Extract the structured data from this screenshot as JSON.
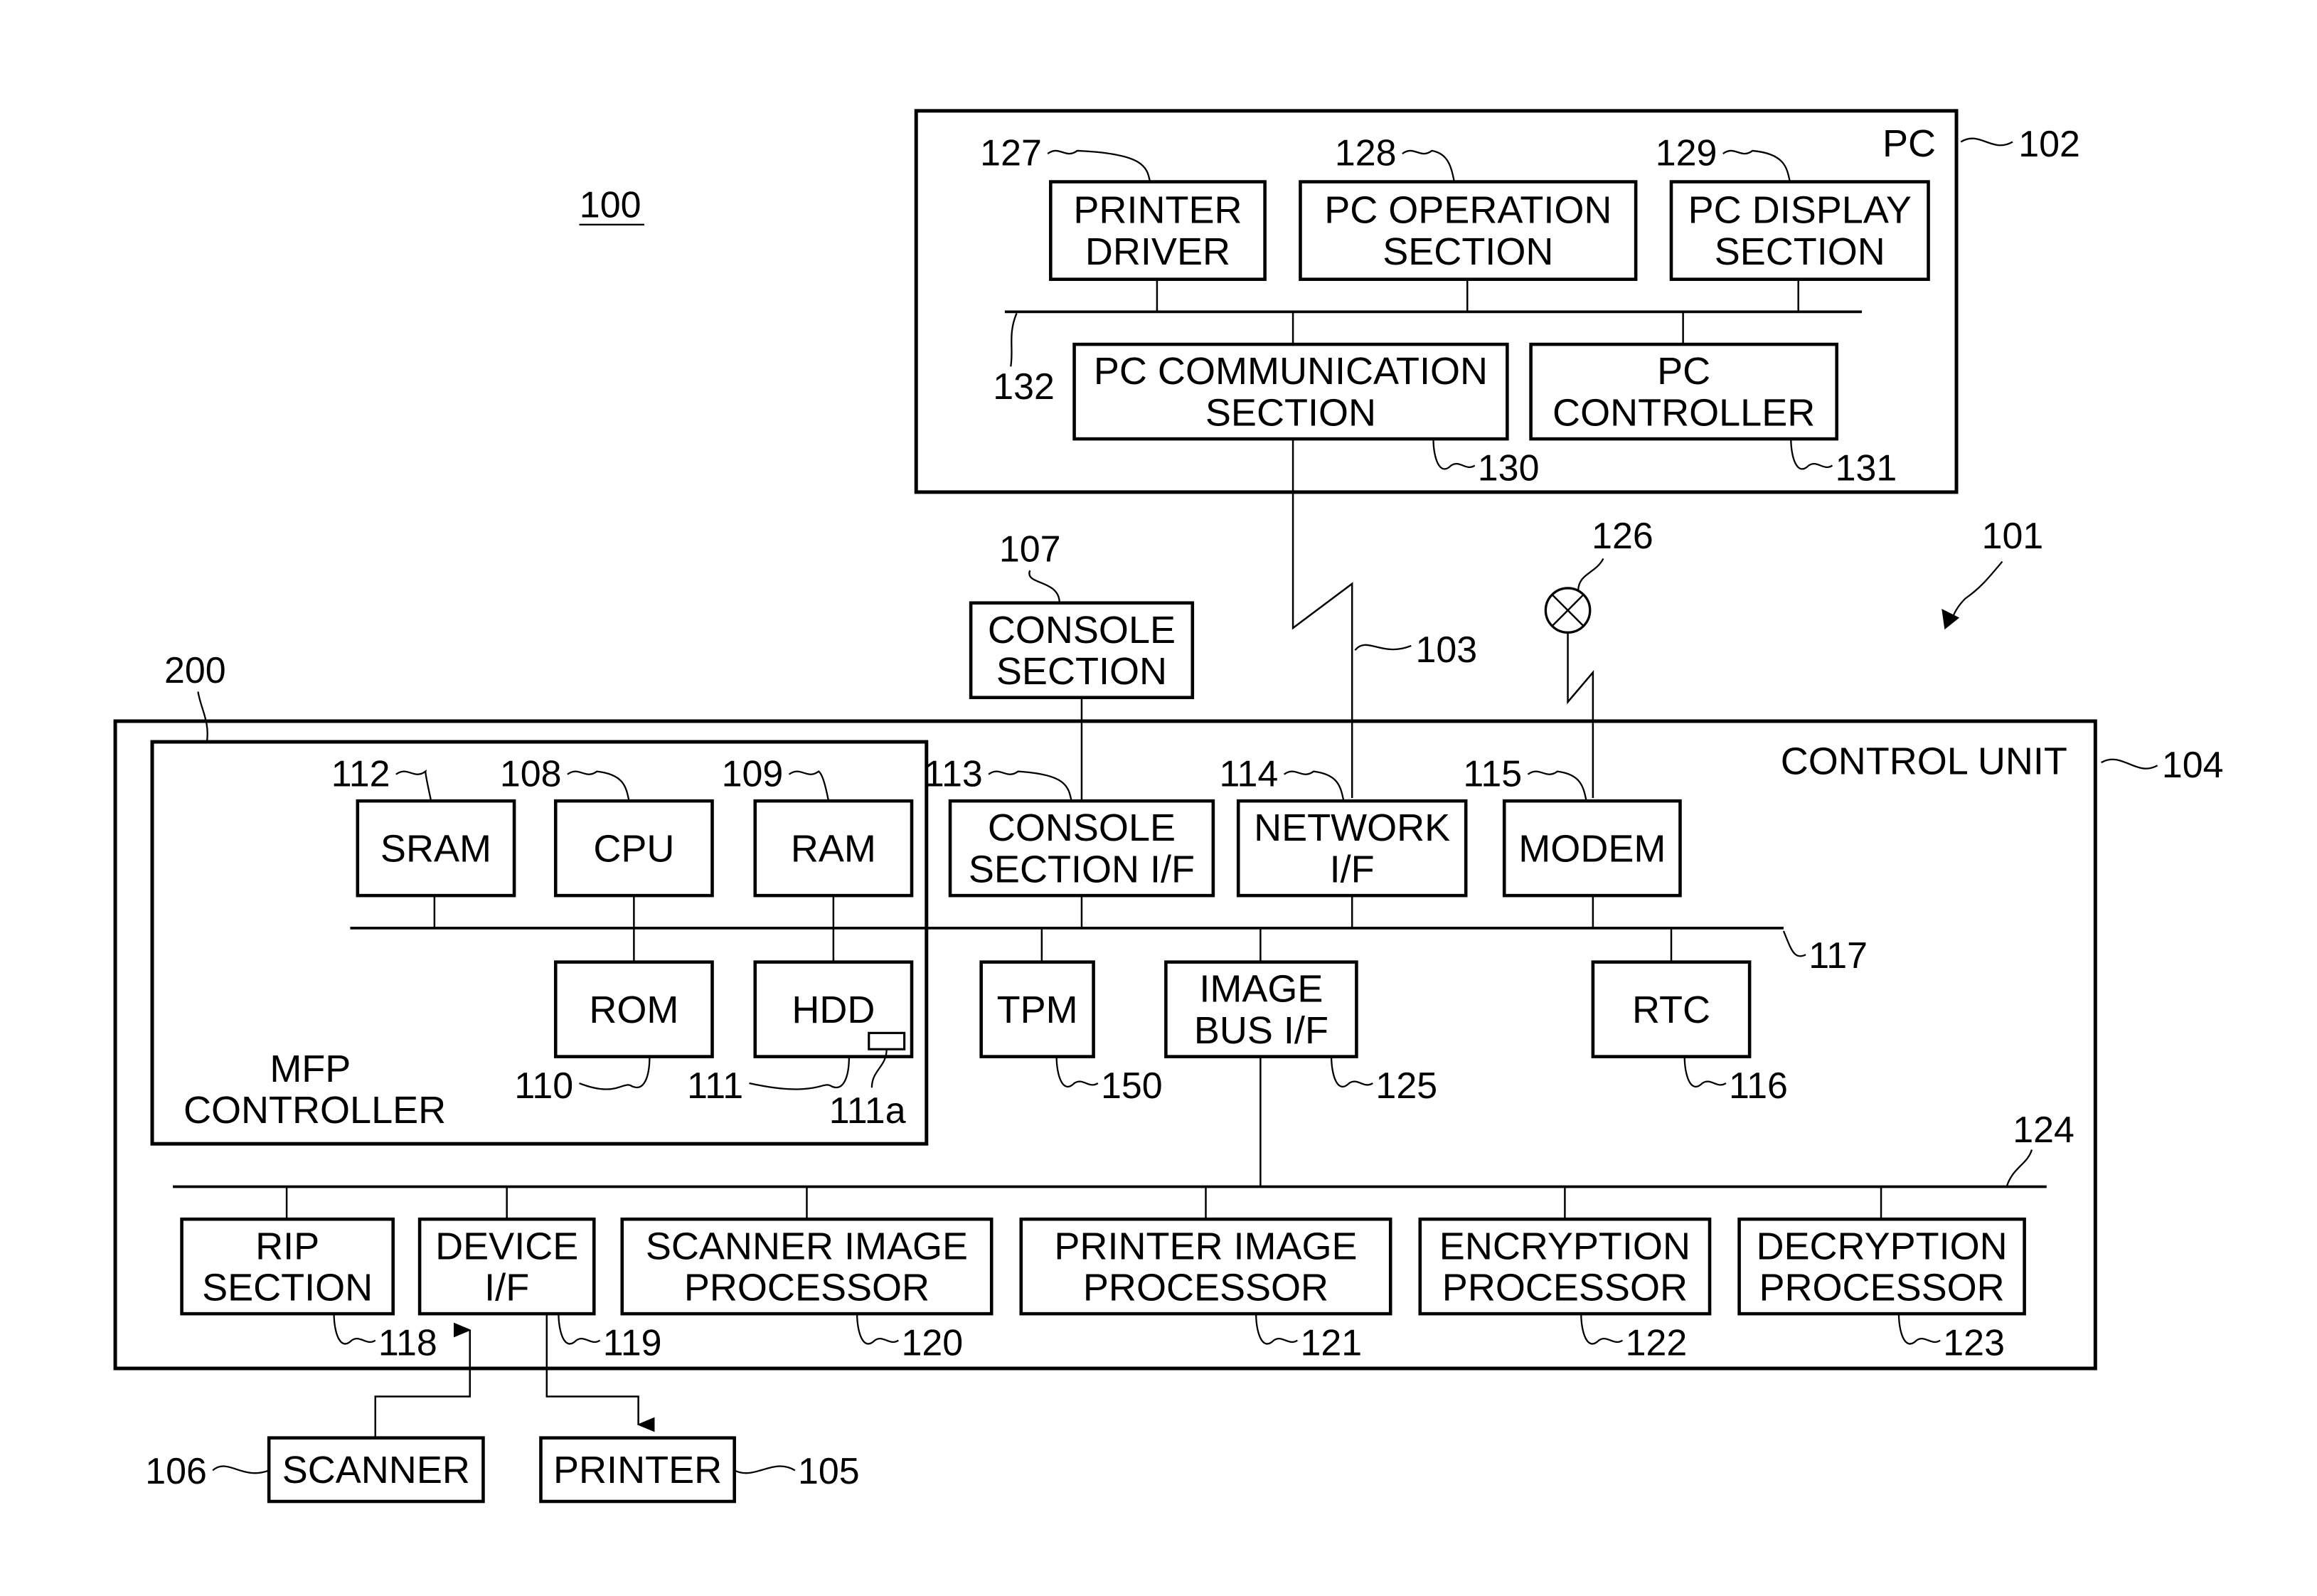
{
  "figure": {
    "system_ref": "100",
    "arrow_ref": "101",
    "pc": {
      "title": "PC",
      "ref": "102"
    },
    "network_ref": "103",
    "control_unit": {
      "title": "CONTROL UNIT",
      "ref": "104"
    },
    "mfp_controller": {
      "title_lines": [
        "MFP",
        "CONTROLLER"
      ],
      "ref": "200"
    },
    "phone_line_ref": "126",
    "pc_bus_ref": "132",
    "system_bus_ref": "117",
    "image_bus_ref": "124"
  },
  "blocks": {
    "printer_driver": {
      "lines": [
        "PRINTER",
        "DRIVER"
      ],
      "ref": "127"
    },
    "pc_operation": {
      "lines": [
        "PC OPERATION",
        "SECTION"
      ],
      "ref": "128"
    },
    "pc_display": {
      "lines": [
        "PC DISPLAY",
        "SECTION"
      ],
      "ref": "129"
    },
    "pc_communication": {
      "lines": [
        "PC COMMUNICATION",
        "SECTION"
      ],
      "ref": "130"
    },
    "pc_controller": {
      "lines": [
        "PC",
        "CONTROLLER"
      ],
      "ref": "131"
    },
    "console_section": {
      "lines": [
        "CONSOLE",
        "SECTION"
      ],
      "ref": "107"
    },
    "sram": {
      "lines": [
        "SRAM"
      ],
      "ref": "112"
    },
    "cpu": {
      "lines": [
        "CPU"
      ],
      "ref": "108"
    },
    "ram": {
      "lines": [
        "RAM"
      ],
      "ref": "109"
    },
    "rom": {
      "lines": [
        "ROM"
      ],
      "ref": "110"
    },
    "hdd": {
      "lines": [
        "HDD"
      ],
      "ref": "111",
      "sub_ref": "111a"
    },
    "console_if": {
      "lines": [
        "CONSOLE",
        "SECTION I/F"
      ],
      "ref": "113"
    },
    "network_if": {
      "lines": [
        "NETWORK",
        "I/F"
      ],
      "ref": "114"
    },
    "modem": {
      "lines": [
        "MODEM"
      ],
      "ref": "115"
    },
    "tpm": {
      "lines": [
        "TPM"
      ],
      "ref": "150"
    },
    "image_bus_if": {
      "lines": [
        "IMAGE",
        "BUS I/F"
      ],
      "ref": "125"
    },
    "rtc": {
      "lines": [
        "RTC"
      ],
      "ref": "116"
    },
    "rip": {
      "lines": [
        "RIP",
        "SECTION"
      ],
      "ref": "118"
    },
    "device_if": {
      "lines": [
        "DEVICE",
        "I/F"
      ],
      "ref": "119"
    },
    "scanner_image": {
      "lines": [
        "SCANNER IMAGE",
        "PROCESSOR"
      ],
      "ref": "120"
    },
    "printer_image": {
      "lines": [
        "PRINTER IMAGE",
        "PROCESSOR"
      ],
      "ref": "121"
    },
    "encryption": {
      "lines": [
        "ENCRYPTION",
        "PROCESSOR"
      ],
      "ref": "122"
    },
    "decryption": {
      "lines": [
        "DECRYPTION",
        "PROCESSOR"
      ],
      "ref": "123"
    },
    "scanner": {
      "lines": [
        "SCANNER"
      ],
      "ref": "106"
    },
    "printer": {
      "lines": [
        "PRINTER"
      ],
      "ref": "105"
    }
  }
}
